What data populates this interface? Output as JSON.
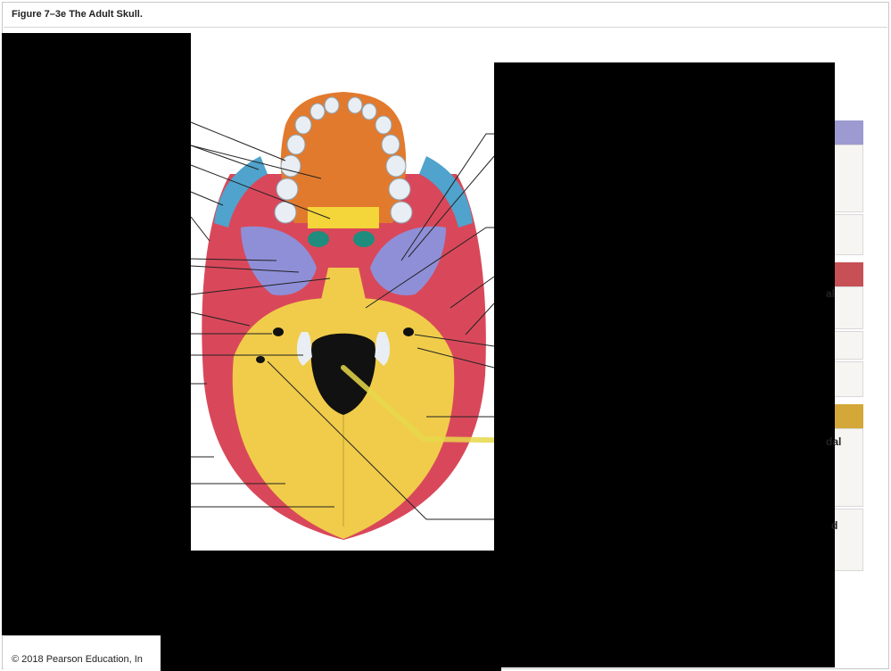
{
  "figure": {
    "title": "Figure 7–3e The Adult Skull.",
    "copyright": "© 2018 Pearson Education, In"
  },
  "legend_fragments": {
    "top": "al",
    "middle": "dal",
    "bottom": "d"
  },
  "colors": {
    "maxilla": "#e27a2e",
    "palatine": "#f4d53a",
    "vomer": "#1f8c7d",
    "zygomatic": "#4fa3cc",
    "sphenoid": "#8f8fd8",
    "temporal": "#d9485a",
    "occipital": "#f0cc4a",
    "teeth": "#e8eef3",
    "highlight": "#e6d84a",
    "legend_purple": "#9c9ad0",
    "legend_red": "#c65055",
    "legend_gold": "#d4a838"
  }
}
